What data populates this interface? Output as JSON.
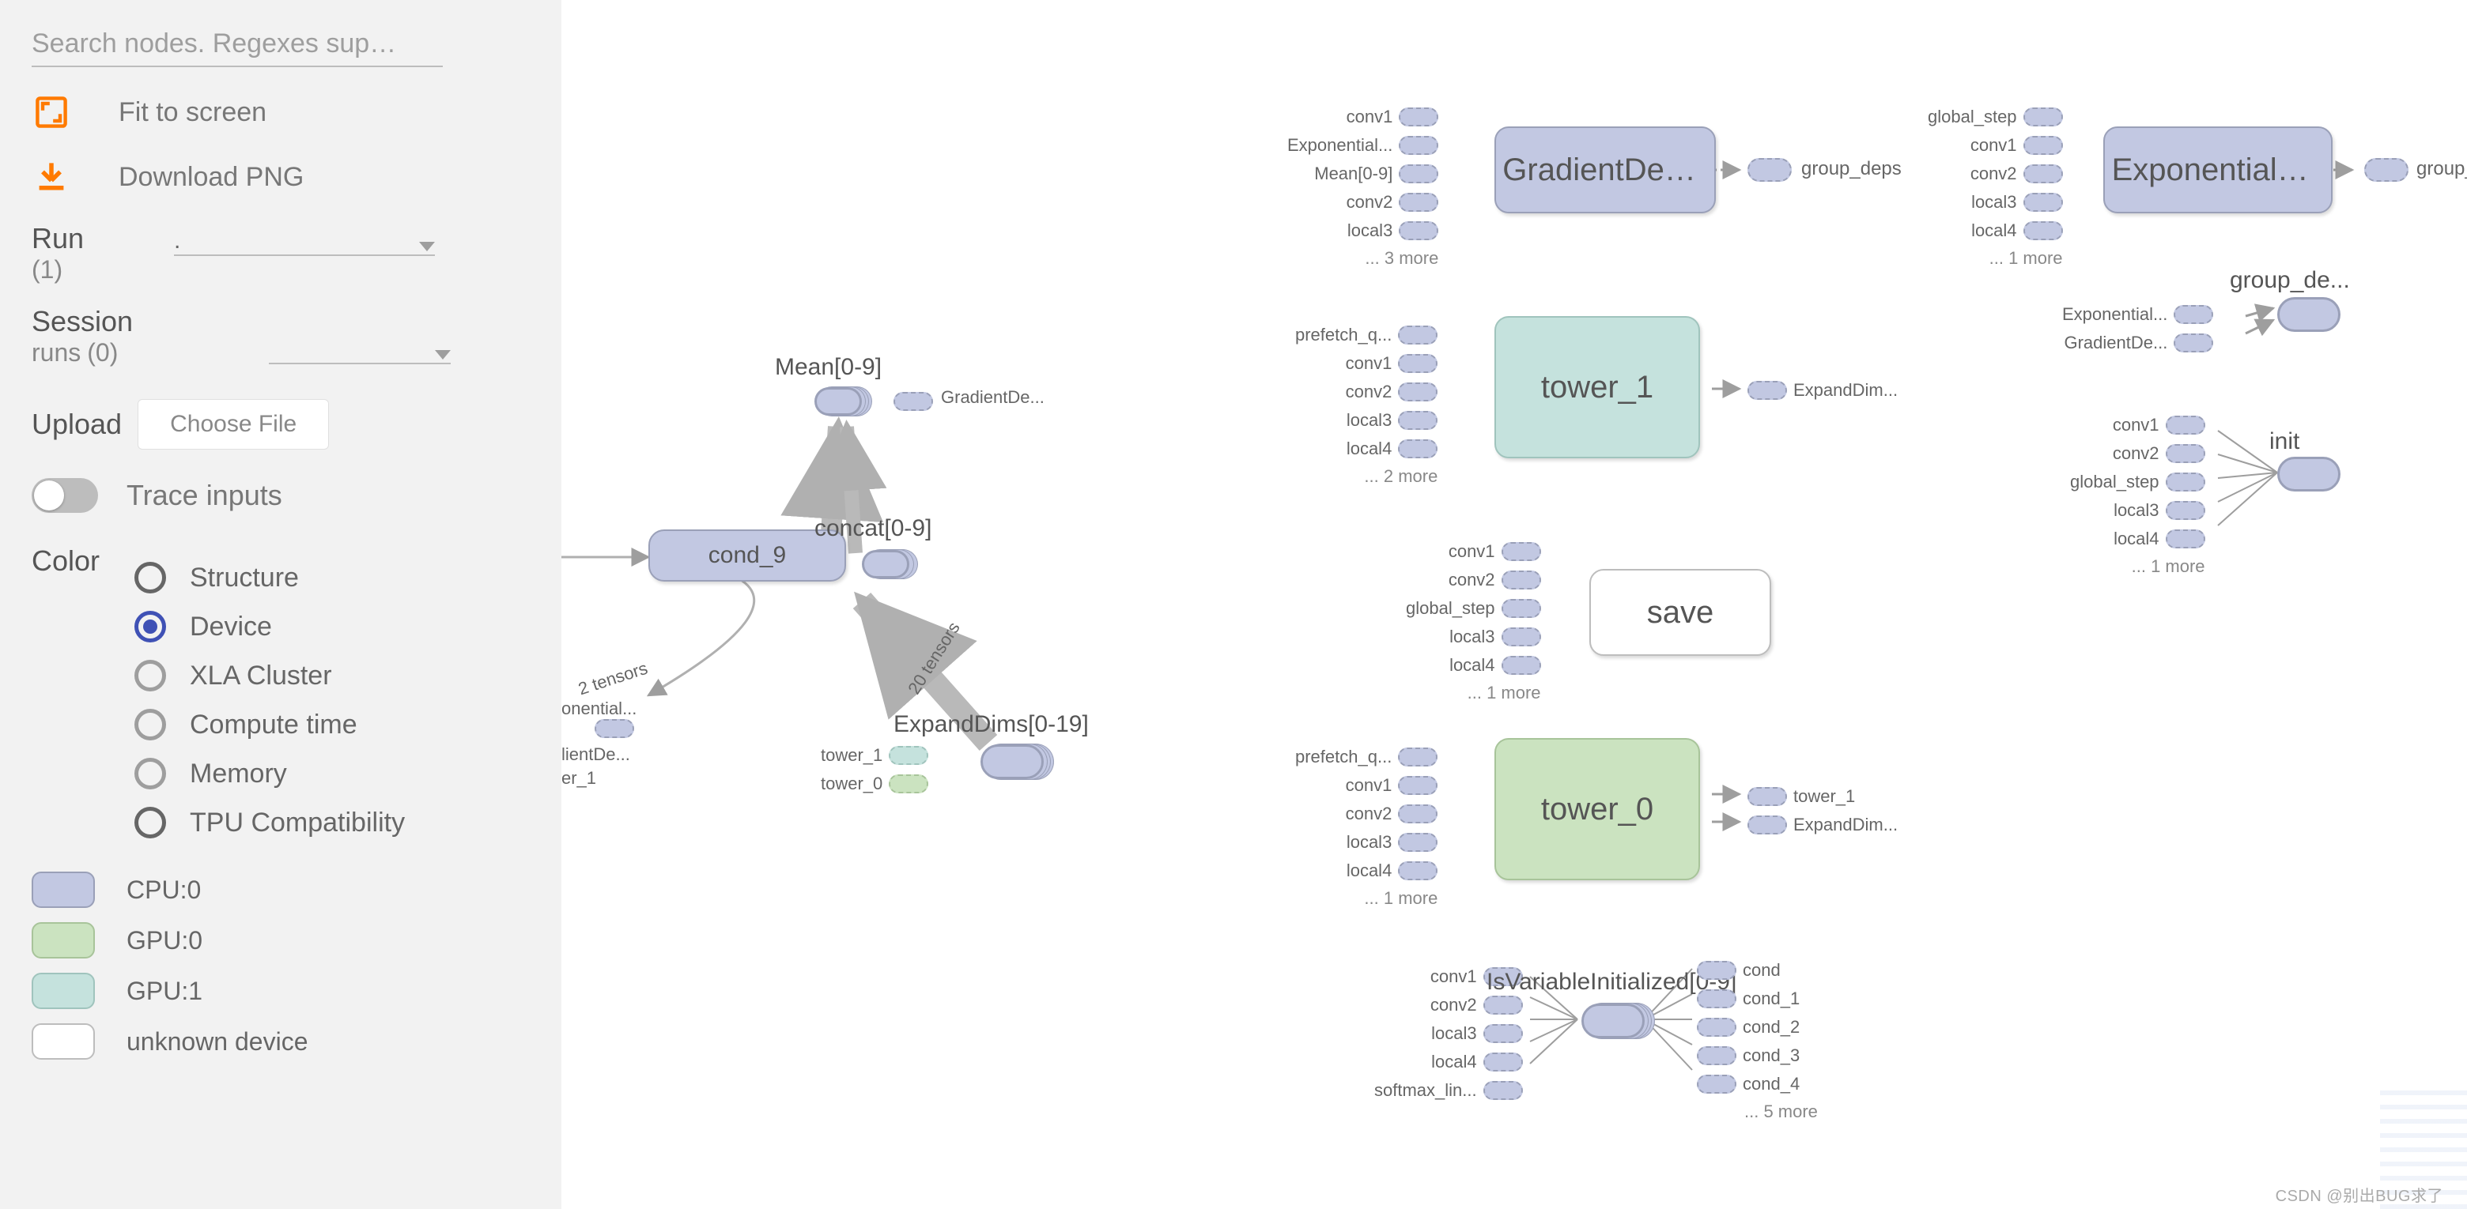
{
  "sidebar": {
    "search_placeholder": "Search nodes. Regexes sup…",
    "fit_label": "Fit to screen",
    "download_label": "Download PNG",
    "run_label": "Run",
    "run_count": "(1)",
    "run_value": ".",
    "session_label": "Session",
    "session_sub": "runs",
    "session_count": "(0)",
    "upload_label": "Upload",
    "choose_file": "Choose File",
    "trace_label": "Trace inputs",
    "color_label": "Color",
    "color_options": [
      "Structure",
      "Device",
      "XLA Cluster",
      "Compute time",
      "Memory",
      "TPU Compatibility"
    ],
    "color_selected": "Device",
    "legend": [
      {
        "label": "CPU:0",
        "color": "#c2c8e2",
        "border": "#9aa0b8"
      },
      {
        "label": "GPU:0",
        "color": "#cbe3c0",
        "border": "#a8c49a"
      },
      {
        "label": "GPU:1",
        "color": "#c5e2dd",
        "border": "#a0c4bd"
      },
      {
        "label": "unknown device",
        "color": "#ffffff",
        "border": "#bdbdbd"
      }
    ]
  },
  "graph": {
    "cond9": {
      "label": "cond_9"
    },
    "mean": {
      "label": "Mean[0-9]",
      "out": "GradientDe..."
    },
    "concat": {
      "label": "concat[0-9]"
    },
    "expanddims": {
      "label": "ExpandDims[0-19]",
      "inputs": [
        "tower_1",
        "tower_0"
      ]
    },
    "edge_tensors_a": "2 tensors",
    "edge_tensors_b": "20 tensors",
    "edgein": [
      "onential...",
      "lientDe...",
      "er_1"
    ],
    "graddesc": {
      "label": "GradientDesc...",
      "inputs": [
        "conv1",
        "Exponential...",
        "Mean[0-9]",
        "conv2",
        "local3"
      ],
      "more": "... 3 more",
      "out": "group_deps"
    },
    "exmov": {
      "label": "ExponentialMovi...",
      "inputs": [
        "global_step",
        "conv1",
        "conv2",
        "local3",
        "local4"
      ],
      "more": "... 1 more",
      "out": "group_deps"
    },
    "grpde": {
      "label": "group_de...",
      "inputs": [
        "Exponential...",
        "GradientDe..."
      ]
    },
    "tower1": {
      "label": "tower_1",
      "inputs": [
        "prefetch_q...",
        "conv1",
        "conv2",
        "local3",
        "local4"
      ],
      "more": "... 2 more",
      "out": [
        "ExpandDim..."
      ]
    },
    "init": {
      "label": "init",
      "inputs": [
        "conv1",
        "conv2",
        "global_step",
        "local3",
        "local4"
      ],
      "more": "... 1 more"
    },
    "save": {
      "label": "save",
      "inputs": [
        "conv1",
        "conv2",
        "global_step",
        "local3",
        "local4"
      ],
      "more": "... 1 more"
    },
    "tower0": {
      "label": "tower_0",
      "inputs": [
        "prefetch_q...",
        "conv1",
        "conv2",
        "local3",
        "local4"
      ],
      "more": "... 1 more",
      "out": [
        "tower_1",
        "ExpandDim..."
      ]
    },
    "isvar": {
      "label": "IsVariableInitialized[0‑9]",
      "inputs": [
        "conv1",
        "conv2",
        "local3",
        "local4",
        "softmax_lin..."
      ],
      "out": [
        "cond",
        "cond_1",
        "cond_2",
        "cond_3",
        "cond_4"
      ],
      "more_out": "... 5 more"
    }
  },
  "watermark": "CSDN @别出BUG求了"
}
